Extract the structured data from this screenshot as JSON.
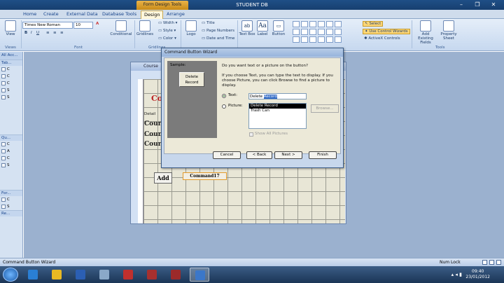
{
  "titlebar": {
    "context_tab": "Form Design Tools",
    "app_title": "STUDENT DB"
  },
  "tabs": [
    "Home",
    "Create",
    "External Data",
    "Database Tools",
    "Design",
    "Arrange"
  ],
  "ribbon": {
    "views": "View",
    "views_group": "Views",
    "font_name": "Times New Roman",
    "font_size": "10",
    "font_group": "Font",
    "conditional": "Conditional",
    "gridlines": "Gridlines",
    "gridlines_group": "Gridlines",
    "width": "Width",
    "style": "Style",
    "color": "Color",
    "logo": "Logo",
    "title": "Title",
    "page_numbers": "Page Numbers",
    "date_time": "Date and Time",
    "text_box": "Text\nBox",
    "label": "Label",
    "button": "Button",
    "select": "Select",
    "use_control_wizards": "Use Control Wizards",
    "activex": "ActiveX Controls",
    "add_existing_fields": "Add Existing Fields",
    "property_sheet": "Property Sheet",
    "tools_group": "Tools"
  },
  "navpane": {
    "header": "All Acc...",
    "sections": [
      {
        "label": "Tab...",
        "items": [
          "C",
          "C",
          "C",
          "S",
          "S"
        ]
      },
      {
        "label": "Qu...",
        "items": [
          "C",
          "A",
          "C",
          "S"
        ]
      },
      {
        "label": "For...",
        "items": [
          "C",
          "S"
        ]
      },
      {
        "label": "Re...",
        "items": []
      }
    ]
  },
  "form": {
    "title": "Course",
    "header_text": "Co",
    "detail": "Detail",
    "labels": [
      "Cours",
      "Cours",
      "Cours"
    ],
    "add_button": "Add",
    "command_button": "Command17"
  },
  "wizard": {
    "title": "Command Button Wizard",
    "sample_label": "Sample:",
    "sample_button": "Delete Record",
    "question": "Do you want text or a picture on the button?",
    "explanation": "If you choose Text, you can type the text to display.  If you choose Picture, you can click Browse to find a picture to display.",
    "text_option": "Text:",
    "text_value_plain": "Delete ",
    "text_value_selected": "Record",
    "picture_option": "Picture:",
    "browse": "Browse...",
    "pictures": [
      "Delete Record",
      "Trash Can"
    ],
    "show_all": "Show All Pictures",
    "buttons": {
      "cancel": "Cancel",
      "back": "< Back",
      "next": "Next >",
      "finish": "Finish"
    }
  },
  "statusbar": {
    "left": "Command Button Wizard",
    "numlock": "Num Lock"
  },
  "taskbar": {
    "time": "09:40",
    "date": "23/01/2012",
    "apps": [
      {
        "icon": "ie-icon",
        "color": "#2a7fd4"
      },
      {
        "icon": "chrome-icon",
        "color": "#e8b923"
      },
      {
        "icon": "word-icon",
        "color": "#2b5fb4"
      },
      {
        "icon": "app-icon",
        "color": "#8aa8c8"
      },
      {
        "icon": "pdf-icon",
        "color": "#c0302e"
      },
      {
        "icon": "access-icon",
        "color": "#a7302f"
      },
      {
        "icon": "access-db-icon",
        "color": "#9c2a2a"
      },
      {
        "icon": "paint-icon",
        "color": "#3b77c9"
      }
    ]
  }
}
